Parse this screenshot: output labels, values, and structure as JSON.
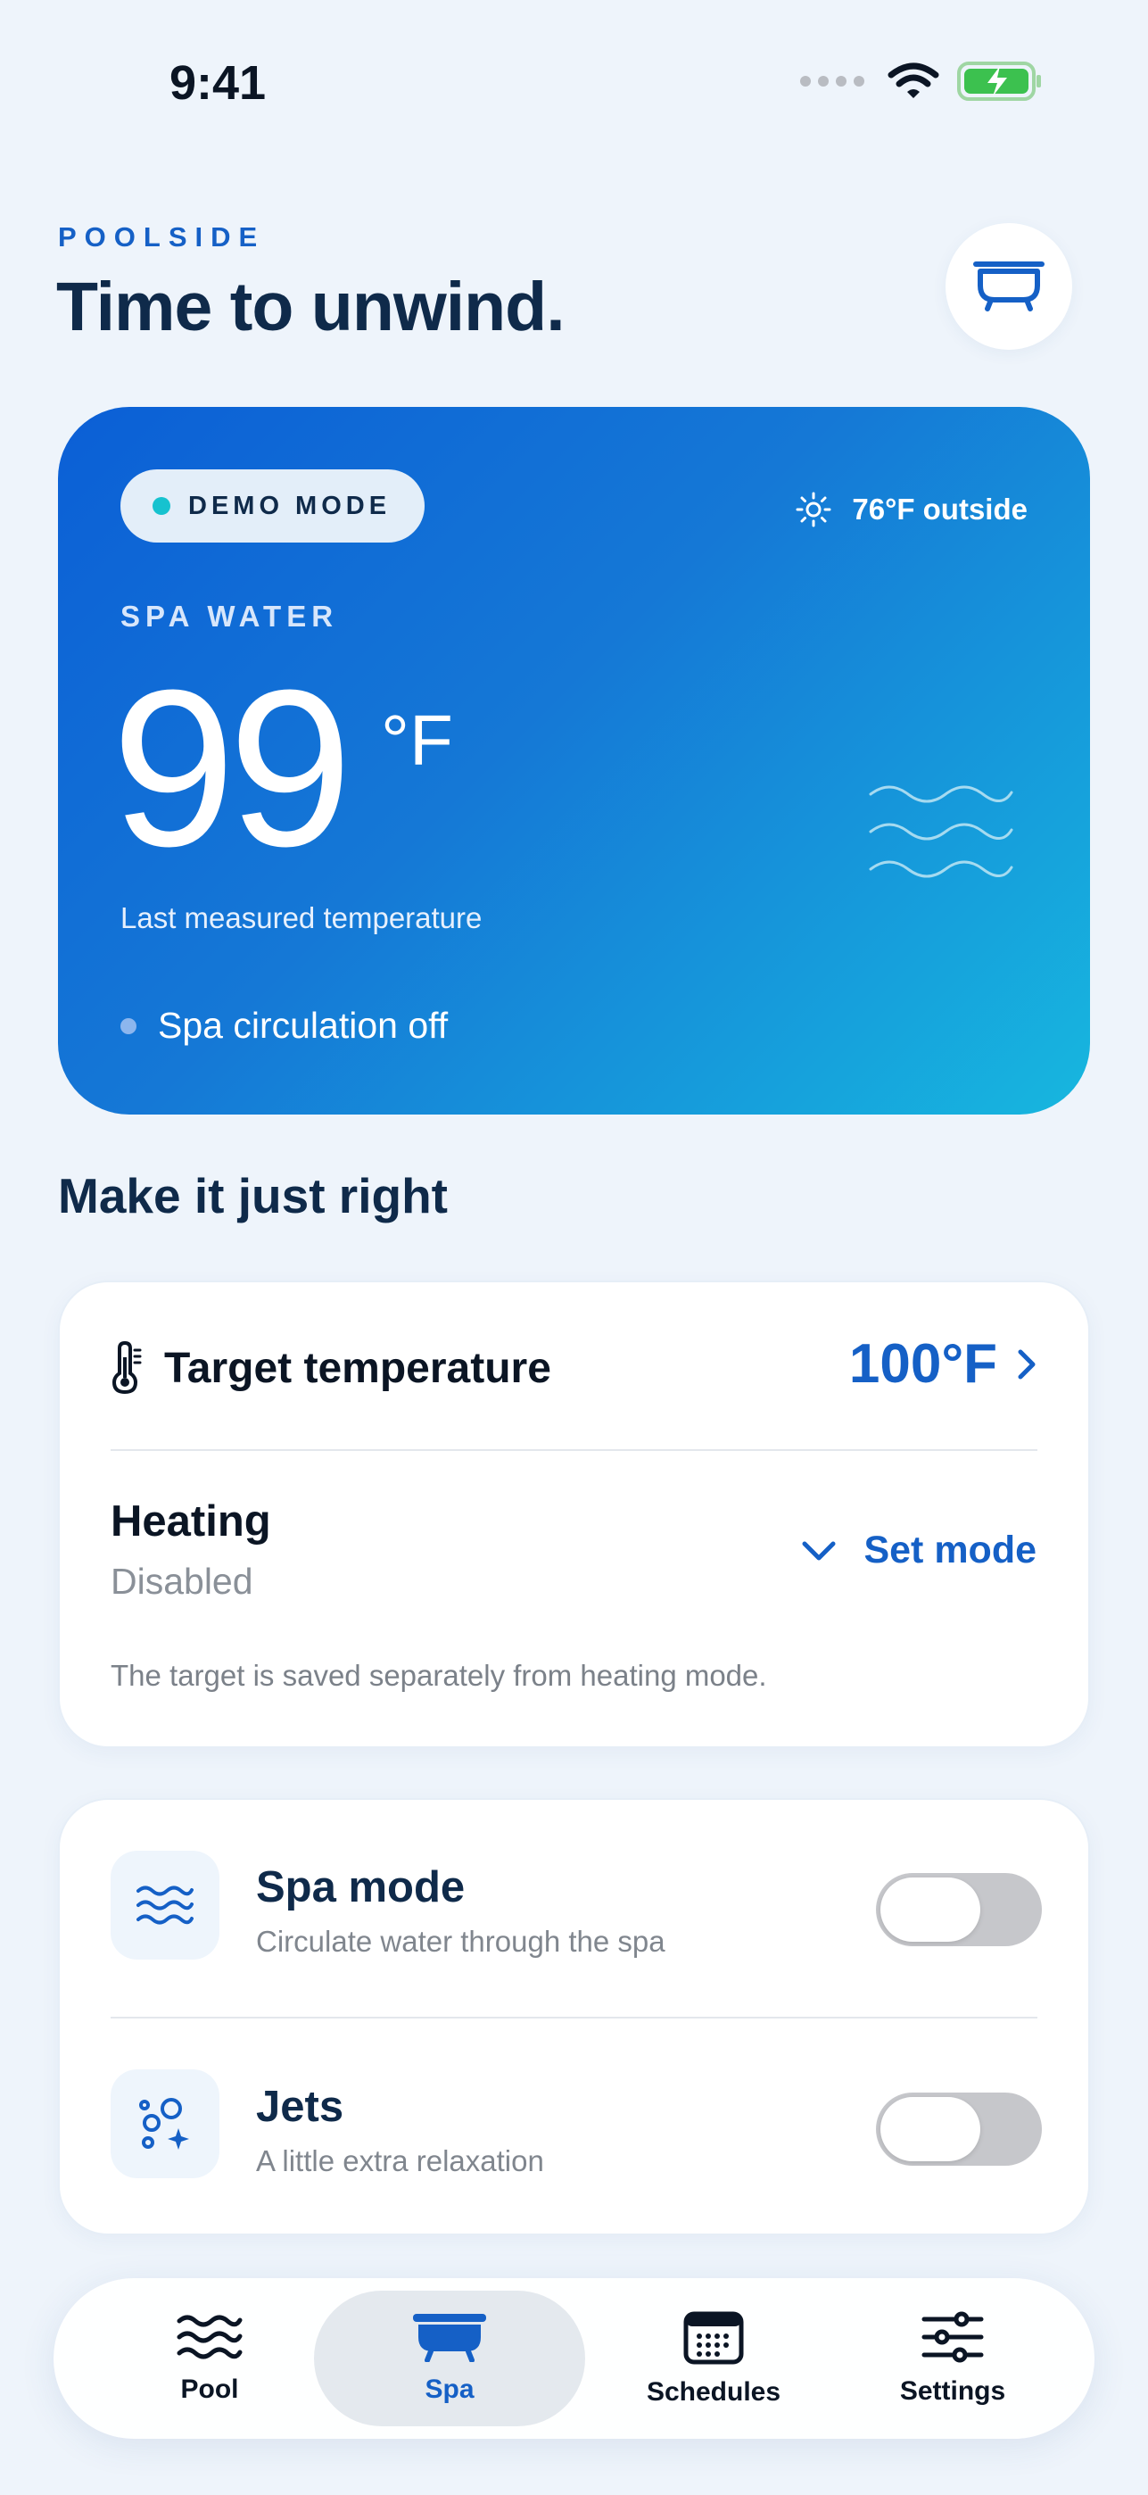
{
  "status": {
    "time": "9:41"
  },
  "header": {
    "eyebrow": "POOLSIDE",
    "title": "Time to unwind."
  },
  "hero": {
    "badge": "DEMO MODE",
    "outside": "76°F outside",
    "label": "SPA WATER",
    "temperature": "99",
    "unit": "°F",
    "caption": "Last measured temperature",
    "circulation": "Spa circulation off"
  },
  "section": {
    "title": "Make it just right"
  },
  "target": {
    "label": "Target temperature",
    "value": "100°F",
    "heating_title": "Heating",
    "heating_status": "Disabled",
    "set_mode": "Set mode",
    "note": "The target is saved separately from heating mode."
  },
  "toggles": [
    {
      "title": "Spa mode",
      "subtitle": "Circulate water through the spa",
      "on": false
    },
    {
      "title": "Jets",
      "subtitle": "A little extra relaxation",
      "on": false
    }
  ],
  "tabs": [
    {
      "label": "Pool",
      "active": false
    },
    {
      "label": "Spa",
      "active": true
    },
    {
      "label": "Schedules",
      "active": false
    },
    {
      "label": "Settings",
      "active": false
    }
  ],
  "colors": {
    "accent": "#1560c6",
    "heroStart": "#0b5fd6",
    "heroEnd": "#17b7df"
  }
}
